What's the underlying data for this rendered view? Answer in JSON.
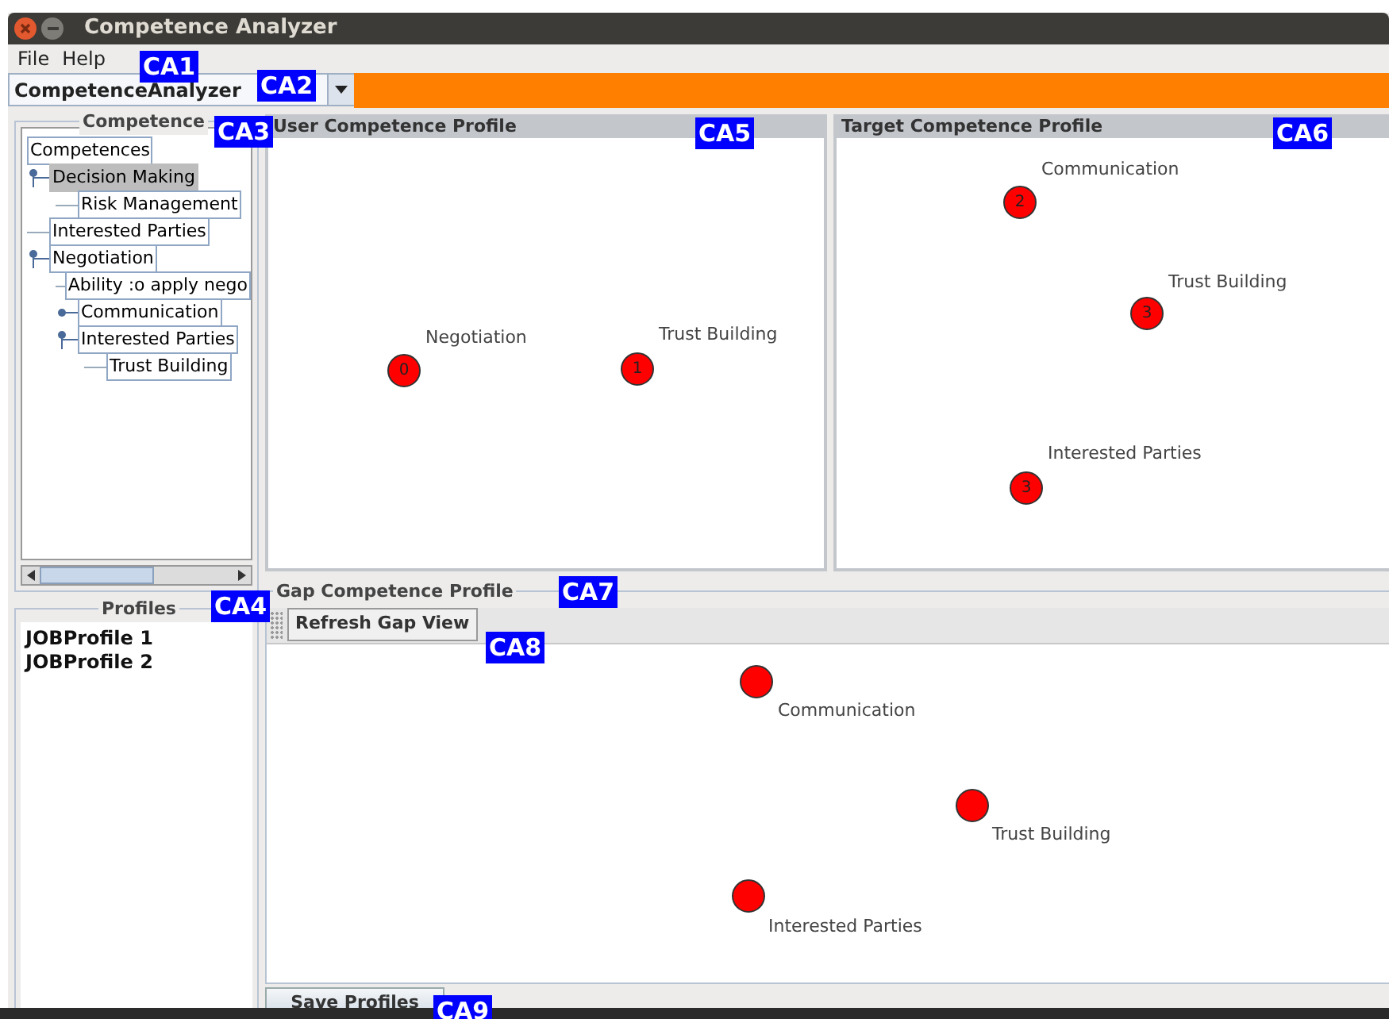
{
  "window": {
    "title": "Competence Analyzer"
  },
  "menu": [
    "File",
    "Help"
  ],
  "combo": {
    "value": "CompetenceAnalyzer"
  },
  "competence_panel": {
    "title": "Competence",
    "tree": [
      {
        "label": "Competences",
        "selected": false,
        "children": [
          {
            "label": "Decision Making",
            "expanded": true,
            "selected": true,
            "children": [
              {
                "label": "Risk Management",
                "selected": false
              }
            ]
          },
          {
            "label": "Interested Parties",
            "selected": false
          },
          {
            "label": "Negotiation",
            "expanded": true,
            "selected": false,
            "children": [
              {
                "label": "Ability :o apply nego",
                "selected": false
              },
              {
                "label": "Communication",
                "expanded": false,
                "selected": false
              },
              {
                "label": "Interested Parties",
                "expanded": true,
                "selected": false,
                "children": [
                  {
                    "label": "Trust Building",
                    "selected": false
                  }
                ]
              }
            ]
          }
        ]
      }
    ]
  },
  "profiles_panel": {
    "title": "Profiles",
    "items": [
      "JOBProfile 1",
      "JOBProfile 2"
    ]
  },
  "user_profile": {
    "title": "User Competence Profile",
    "nodes": [
      {
        "label": "Negotiation",
        "value": "0"
      },
      {
        "label": "Trust Building",
        "value": "1"
      }
    ]
  },
  "target_profile": {
    "title": "Target Competence Profile",
    "nodes": [
      {
        "label": "Communication",
        "value": "2"
      },
      {
        "label": "Trust Building",
        "value": "3"
      },
      {
        "label": "Interested Parties",
        "value": "3"
      }
    ]
  },
  "gap_profile": {
    "title": "Gap Competence Profile",
    "refresh_button": "Refresh Gap View",
    "nodes": [
      {
        "label": "Communication"
      },
      {
        "label": "Trust Building"
      },
      {
        "label": "Interested Parties"
      }
    ]
  },
  "save_button": "Save Profiles",
  "callouts": [
    "CA1",
    "CA2",
    "CA3",
    "CA4",
    "CA5",
    "CA6",
    "CA7",
    "CA8",
    "CA9"
  ]
}
